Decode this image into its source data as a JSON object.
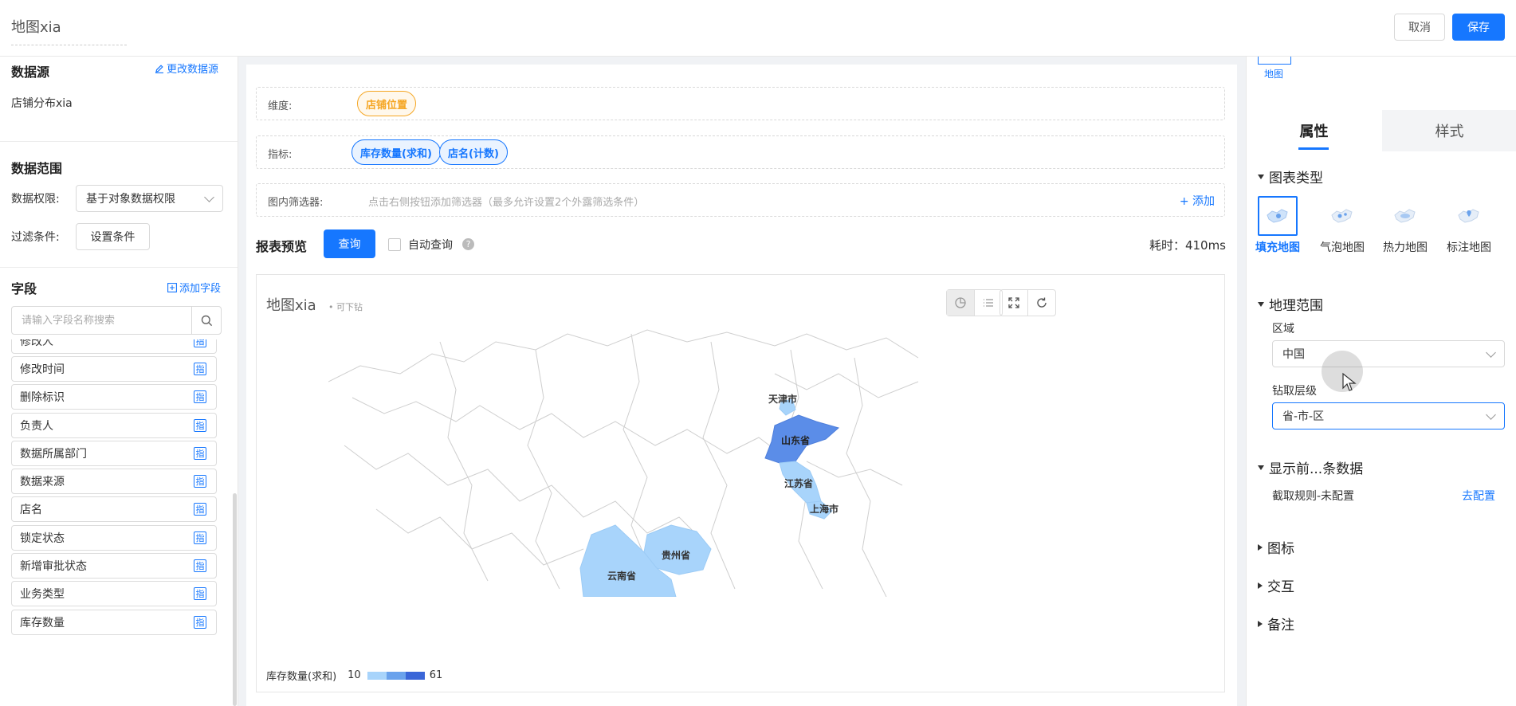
{
  "header": {
    "title": "地图xia",
    "cancel_label": "取消",
    "save_label": "保存"
  },
  "left": {
    "datasource_title": "数据源",
    "change_datasource": "更改数据源",
    "datasource_name": "店铺分布xia",
    "range_title": "数据范围",
    "permission_label": "数据权限:",
    "permission_value": "基于对象数据权限",
    "filter_label": "过滤条件:",
    "filter_button": "设置条件",
    "fields_title": "字段",
    "add_field": "添加字段",
    "search_placeholder": "请输入字段名称搜索",
    "fields": [
      {
        "name": "修改人",
        "tag": "指"
      },
      {
        "name": "修改时间",
        "tag": "指"
      },
      {
        "name": "删除标识",
        "tag": "指"
      },
      {
        "name": "负责人",
        "tag": "指"
      },
      {
        "name": "数据所属部门",
        "tag": "指"
      },
      {
        "name": "数据来源",
        "tag": "指"
      },
      {
        "name": "店名",
        "tag": "指"
      },
      {
        "name": "锁定状态",
        "tag": "指"
      },
      {
        "name": "新增审批状态",
        "tag": "指"
      },
      {
        "name": "业务类型",
        "tag": "指"
      },
      {
        "name": "库存数量",
        "tag": "指"
      }
    ]
  },
  "config": {
    "dimension_label": "维度:",
    "dimension_pill": "店铺位置",
    "metric_label": "指标:",
    "metric_pills": [
      "库存数量(求和)",
      "店名(计数)"
    ],
    "filter_label": "图内筛选器:",
    "filter_hint": "点击右侧按钮添加筛选器（最多允许设置2个外露筛选条件）",
    "add_label": "+ 添加"
  },
  "preview": {
    "title": "报表预览",
    "query_button": "查询",
    "auto_query_label": "自动查询",
    "help_mark": "?",
    "elapsed": "耗时：410ms",
    "chart_title": "地图xia",
    "drill_hint": "• 可下钻",
    "legend_label": "库存数量(求和)",
    "legend_min": "10",
    "legend_max": "61",
    "regions": [
      {
        "name": "天津市",
        "color": "#a8d4fb"
      },
      {
        "name": "山东省",
        "color": "#5b8de8"
      },
      {
        "name": "江苏省",
        "color": "#a8d4fb"
      },
      {
        "name": "上海市",
        "color": "#a8d4fb"
      },
      {
        "name": "贵州省",
        "color": "#a8d4fb"
      },
      {
        "name": "云南省",
        "color": "#a8d4fb"
      }
    ]
  },
  "right": {
    "map_thumb_label": "地图",
    "tabs": [
      "属性",
      "样式"
    ],
    "chart_type_title": "图表类型",
    "chart_types": [
      "填充地图",
      "气泡地图",
      "热力地图",
      "标注地图"
    ],
    "geo_title": "地理范围",
    "region_label": "区域",
    "region_value": "中国",
    "drill_label": "钻取层级",
    "drill_value": "省-市-区",
    "topn_title": "显示前...条数据",
    "rule_text": "截取规则-未配置",
    "rule_link": "去配置",
    "collapsed_sections": [
      "图标",
      "交互",
      "备注"
    ]
  },
  "colors": {
    "primary": "#1677ff",
    "orange": "#f5a623",
    "light_blue": "#a8d4fb",
    "mid_blue": "#5b8de8",
    "dark_blue": "#3a66d8"
  }
}
